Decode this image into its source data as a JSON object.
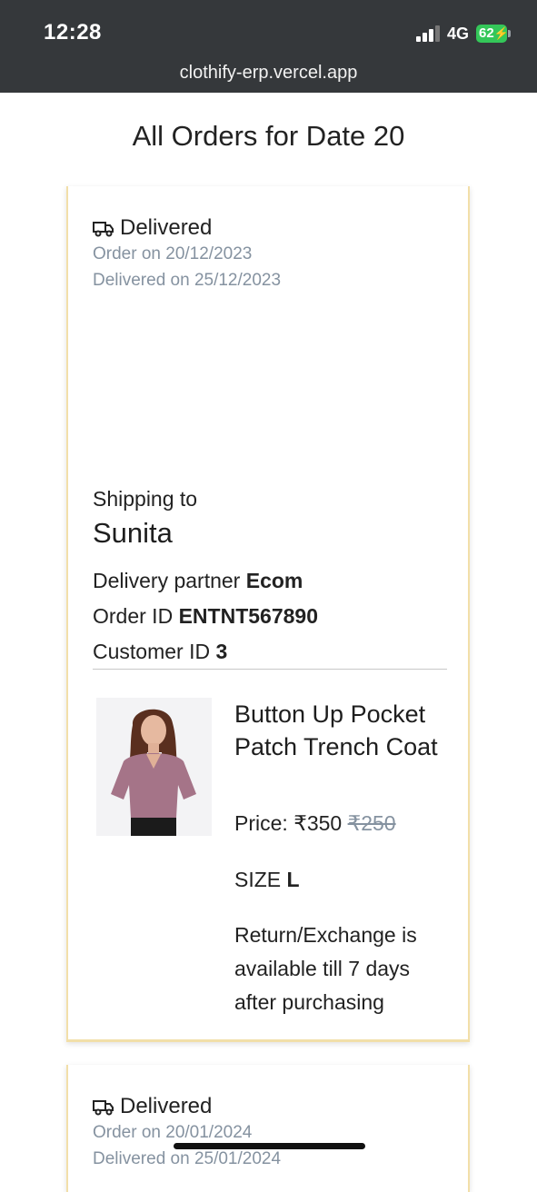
{
  "status_bar": {
    "time": "12:28",
    "network": "4G",
    "battery": "62",
    "url": "clothify-erp.vercel.app"
  },
  "page": {
    "title": "All Orders for Date 20"
  },
  "orders": [
    {
      "status": "Delivered",
      "ordered_on": "Order on 20/12/2023",
      "delivered_on": "Delivered on 25/12/2023",
      "shipping_label": "Shipping to",
      "customer_name": "Sunita",
      "partner_label": "Delivery partner ",
      "partner": "Ecom",
      "order_id_label": "Order ID ",
      "order_id": "ENTNT567890",
      "customer_id_label": "Customer ID ",
      "customer_id": "3",
      "product": {
        "name": "Button Up Pocket Patch Trench Coat",
        "price_label": "Price: ",
        "price": "₹350",
        "original_price": "₹250",
        "size_label": "SIZE ",
        "size": "L",
        "return_note": "Return/Exchange is available till 7 days after purchasing"
      }
    },
    {
      "status": "Delivered",
      "ordered_on": "Order on 20/01/2024",
      "delivered_on": "Delivered on 25/01/2024"
    }
  ]
}
